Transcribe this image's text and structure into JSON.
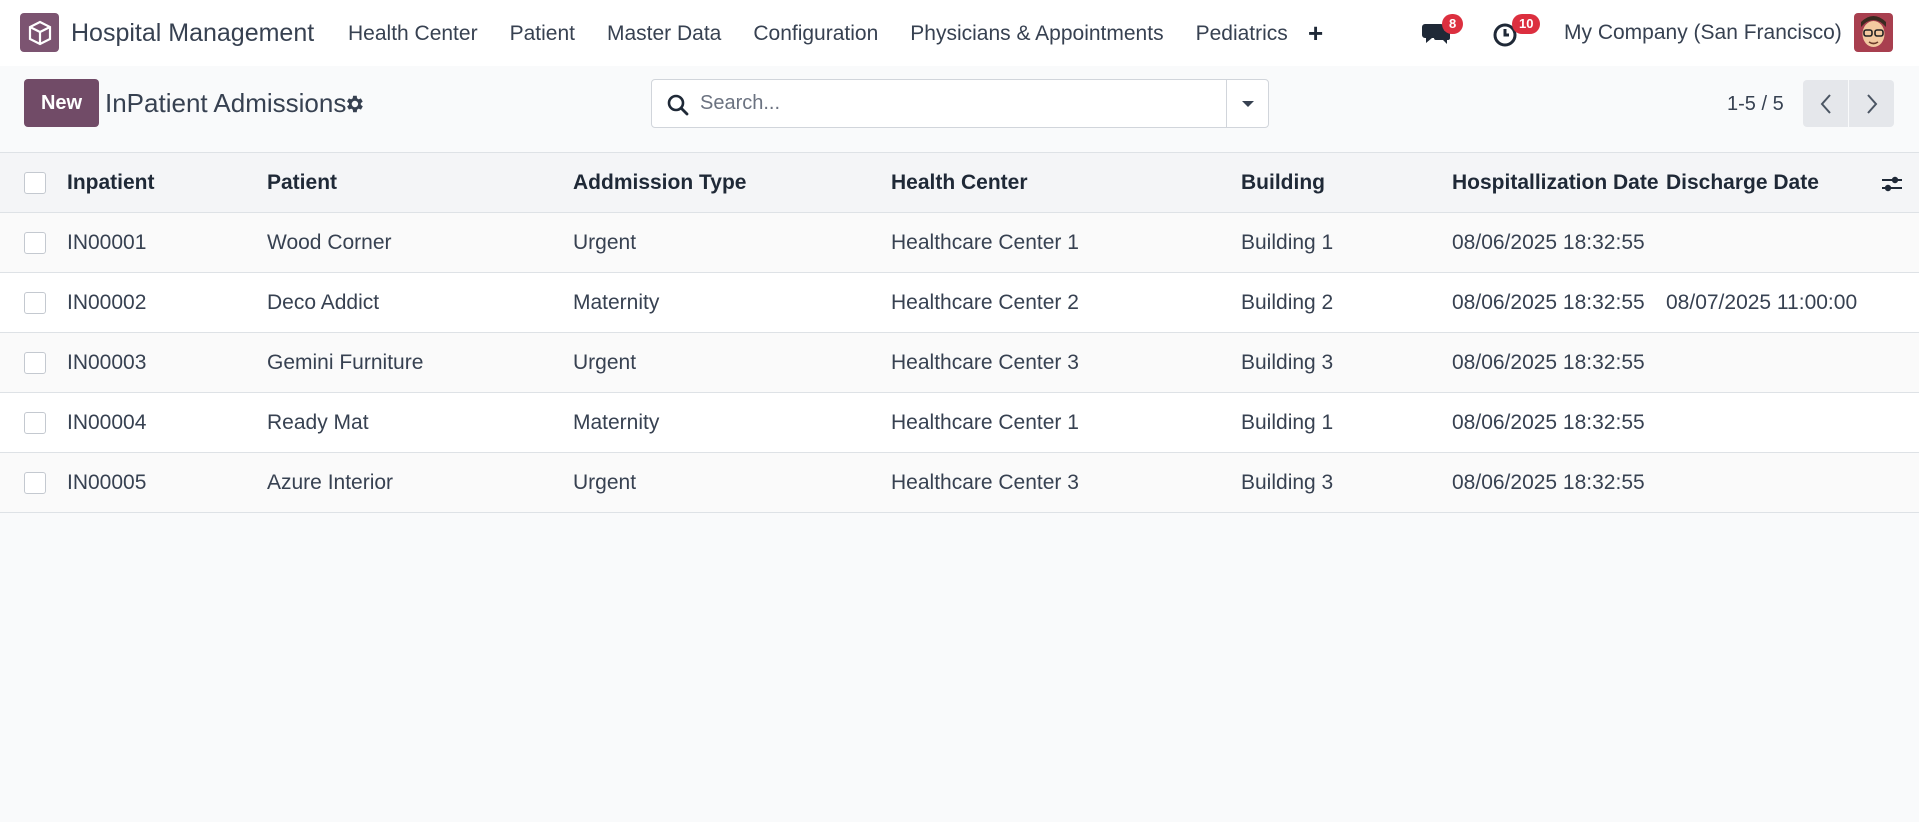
{
  "app": {
    "name": "Hospital Management"
  },
  "nav": {
    "items": [
      {
        "label": "Health Center"
      },
      {
        "label": "Patient"
      },
      {
        "label": "Master Data"
      },
      {
        "label": "Configuration"
      },
      {
        "label": "Physicians & Appointments"
      },
      {
        "label": "Pediatrics"
      }
    ],
    "plus_icon": "+"
  },
  "systray": {
    "messages_count": "8",
    "activities_count": "10",
    "company": "My Company (San Francisco)"
  },
  "control": {
    "new_label": "New",
    "title": "InPatient Admissions",
    "search_placeholder": "Search...",
    "pager": "1-5 / 5"
  },
  "table": {
    "columns": [
      "Inpatient",
      "Patient",
      "Addmission Type",
      "Health Center",
      "Building",
      "Hospitallization Date",
      "Discharge Date"
    ],
    "rows": [
      [
        "IN00001",
        "Wood Corner",
        "Urgent",
        "Healthcare Center 1",
        "Building 1",
        "08/06/2025 18:32:55",
        ""
      ],
      [
        "IN00002",
        "Deco Addict",
        "Maternity",
        "Healthcare Center 2",
        "Building 2",
        "08/06/2025 18:32:55",
        "08/07/2025 11:00:00"
      ],
      [
        "IN00003",
        "Gemini Furniture",
        "Urgent",
        "Healthcare Center 3",
        "Building 3",
        "08/06/2025 18:32:55",
        ""
      ],
      [
        "IN00004",
        "Ready Mat",
        "Maternity",
        "Healthcare Center 1",
        "Building 1",
        "08/06/2025 18:32:55",
        ""
      ],
      [
        "IN00005",
        "Azure Interior",
        "Urgent",
        "Healthcare Center 3",
        "Building 3",
        "08/06/2025 18:32:55",
        ""
      ]
    ]
  },
  "colors": {
    "brand": "#714b67",
    "badge": "#dc2f3f"
  },
  "icons": [
    "app-logo-icon",
    "chat-icon",
    "clock-icon",
    "gear-icon",
    "search-icon",
    "caret-down-icon",
    "chevron-left-icon",
    "chevron-right-icon",
    "column-settings-icon"
  ]
}
